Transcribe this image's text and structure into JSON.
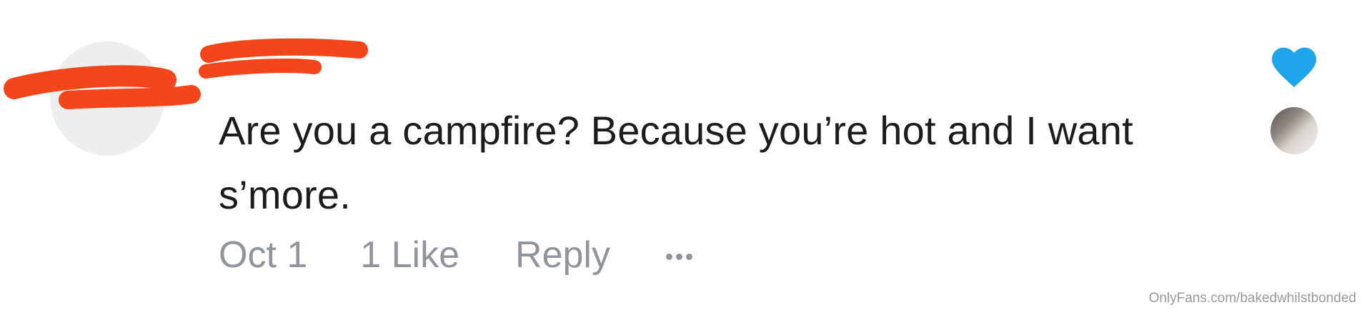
{
  "comment": {
    "text": "Are you a campfire? Because you’re hot and I want s’more.",
    "date": "Oct 1",
    "likes_label": "1 Like",
    "reply_label": "Reply",
    "more_icon": "more-horizontal-icon",
    "heart_icon": "heart-icon",
    "heart_color": "#1fa6ea",
    "redaction_color": "#f4461a"
  },
  "watermark": "OnlyFans.com/bakedwhilstbonded"
}
